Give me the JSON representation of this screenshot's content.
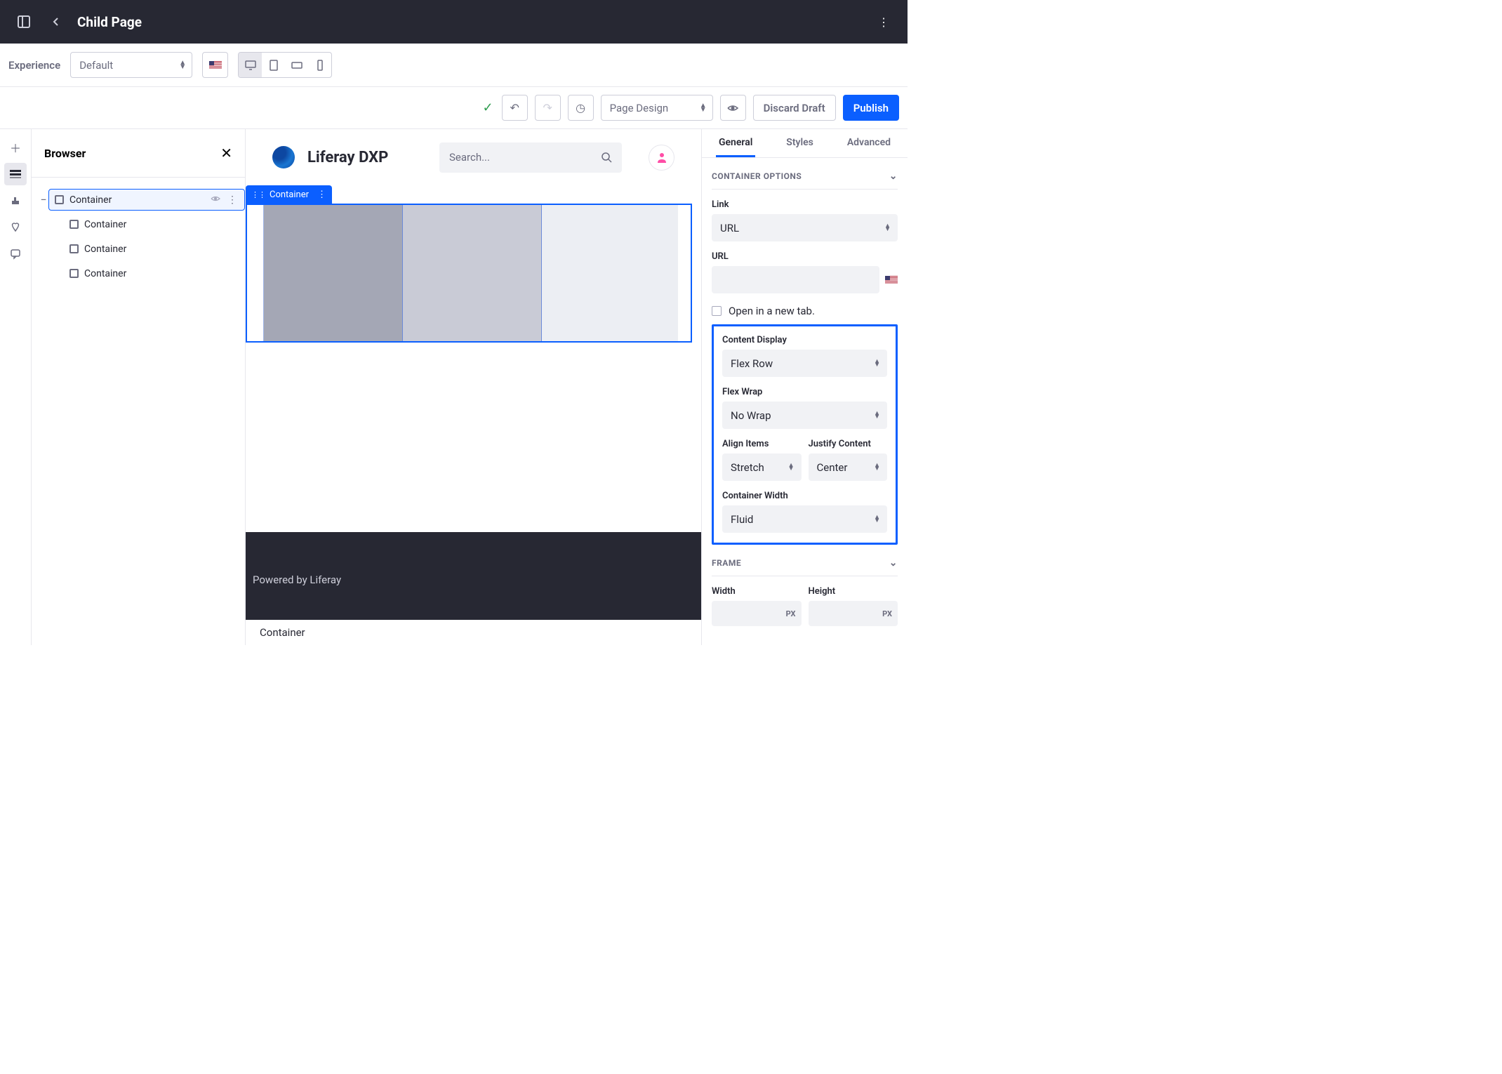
{
  "topbar": {
    "title": "Child Page"
  },
  "toolbar1": {
    "experience_label": "Experience",
    "experience_value": "Default"
  },
  "toolbar2": {
    "page_design": "Page Design",
    "discard": "Discard Draft",
    "publish": "Publish"
  },
  "browser": {
    "title": "Browser",
    "items": [
      {
        "label": "Container",
        "selected": true,
        "children": [
          {
            "label": "Container"
          },
          {
            "label": "Container"
          },
          {
            "label": "Container"
          }
        ]
      }
    ]
  },
  "canvas": {
    "brand": "Liferay DXP",
    "search_placeholder": "Search...",
    "selected_tag": "Container",
    "footer": "Powered by Liferay",
    "bottom": "Container"
  },
  "panel": {
    "tabs": [
      "General",
      "Styles",
      "Advanced"
    ],
    "section1": "CONTAINER OPTIONS",
    "link": {
      "label": "Link",
      "value": "URL"
    },
    "url": {
      "label": "URL"
    },
    "newtab": "Open in a new tab.",
    "content_display": {
      "label": "Content Display",
      "value": "Flex Row"
    },
    "flex_wrap": {
      "label": "Flex Wrap",
      "value": "No Wrap"
    },
    "align": {
      "label": "Align Items",
      "value": "Stretch"
    },
    "justify": {
      "label": "Justify Content",
      "value": "Center"
    },
    "container_width": {
      "label": "Container Width",
      "value": "Fluid"
    },
    "section2": "FRAME",
    "width": {
      "label": "Width",
      "unit": "PX"
    },
    "height": {
      "label": "Height",
      "unit": "PX"
    }
  }
}
